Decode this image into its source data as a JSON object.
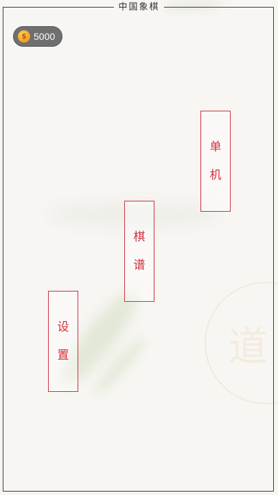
{
  "app": {
    "title": "中国象棋"
  },
  "currency": {
    "icon": "coin-icon",
    "amount": "5000"
  },
  "menu": {
    "single": {
      "chars": [
        "单",
        "机"
      ]
    },
    "record": {
      "chars": [
        "棋",
        "谱"
      ]
    },
    "settings": {
      "chars": [
        "设",
        "置"
      ]
    }
  },
  "watermark": {
    "char": "道"
  },
  "colors": {
    "accent": "#d32f3b",
    "frame": "#3a3a3a",
    "background": "#f8f6f3",
    "coin_pill": "#6f6f6f"
  }
}
